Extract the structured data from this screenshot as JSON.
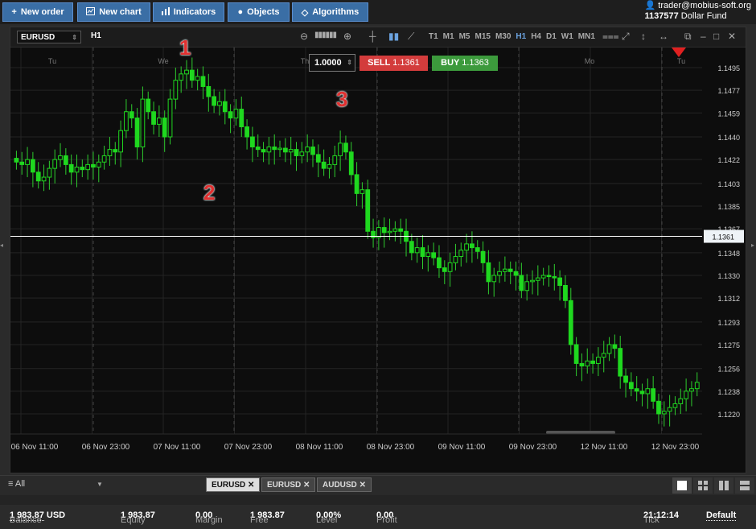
{
  "toolbar": {
    "new_order": "New order",
    "new_chart": "New chart",
    "indicators": "Indicators",
    "objects": "Objects",
    "algorithms": "Algorithms"
  },
  "account": {
    "email": "trader@mobius-soft.org",
    "number": "1137577",
    "fund": "Dollar Fund"
  },
  "chart": {
    "symbol": "EURUSD",
    "timeframe": "H1",
    "timeframes": [
      "T1",
      "M1",
      "M5",
      "M15",
      "M30",
      "H1",
      "H4",
      "D1",
      "W1",
      "MN1"
    ],
    "active_timeframe": "H1",
    "quantity": "1.0000",
    "sell_label": "SELL",
    "sell_price": "1.1361",
    "buy_label": "BUY",
    "buy_price": "1.1363",
    "current_price": "1.1361",
    "day_labels": [
      "Tu",
      "We",
      "Th",
      "Mo",
      "Tu"
    ],
    "annotations": [
      "1",
      "2",
      "3"
    ]
  },
  "chart_data": {
    "type": "candlestick",
    "x_ticks": [
      "06 Nov 11:00",
      "06 Nov 23:00",
      "07 Nov 11:00",
      "07 Nov 23:00",
      "08 Nov 11:00",
      "08 Nov 23:00",
      "09 Nov 11:00",
      "09 Nov 23:00",
      "12 Nov 11:00",
      "12 Nov 23:00"
    ],
    "y_ticks": [
      "1.1495",
      "1.1477",
      "1.1459",
      "1.1440",
      "1.1422",
      "1.1403",
      "1.1385",
      "1.1367",
      "1.1348",
      "1.1330",
      "1.1312",
      "1.1293",
      "1.1275",
      "1.1256",
      "1.1238",
      "1.1220"
    ],
    "ylim": [
      1.1204,
      1.1511
    ],
    "close_series": [
      1.142,
      1.1418,
      1.1422,
      1.1412,
      1.1405,
      1.1408,
      1.1415,
      1.1422,
      1.1425,
      1.1418,
      1.1412,
      1.1416,
      1.1414,
      1.1418,
      1.1416,
      1.142,
      1.1425,
      1.143,
      1.1428,
      1.1445,
      1.146,
      1.1455,
      1.1432,
      1.147,
      1.146,
      1.145,
      1.1455,
      1.144,
      1.147,
      1.1485,
      1.149,
      1.1493,
      1.1485,
      1.1488,
      1.148,
      1.1472,
      1.1465,
      1.1468,
      1.146,
      1.1455,
      1.1462,
      1.1448,
      1.144,
      1.1432,
      1.143,
      1.1428,
      1.1432,
      1.143,
      1.1431,
      1.1428,
      1.143,
      1.1425,
      1.1428,
      1.1432,
      1.1426,
      1.142,
      1.1415,
      1.1418,
      1.1425,
      1.1435,
      1.1428,
      1.141,
      1.1395,
      1.1398,
      1.1365,
      1.136,
      1.1368,
      1.1364,
      1.1365,
      1.1367,
      1.1365,
      1.1357,
      1.1348,
      1.1352,
      1.1345,
      1.1348,
      1.1344,
      1.1336,
      1.1333,
      1.134,
      1.1345,
      1.135,
      1.1355,
      1.1352,
      1.1349,
      1.134,
      1.1325,
      1.133,
      1.1333,
      1.1335,
      1.1333,
      1.133,
      1.1318,
      1.1325,
      1.1326,
      1.1328,
      1.133,
      1.1329,
      1.1328,
      1.1322,
      1.131,
      1.1275,
      1.126,
      1.1258,
      1.1262,
      1.126,
      1.1265,
      1.1268,
      1.1275,
      1.1272,
      1.125,
      1.1245,
      1.124,
      1.1238,
      1.1236,
      1.124,
      1.123,
      1.122,
      1.1222,
      1.1225,
      1.1228,
      1.1232,
      1.1238,
      1.124,
      1.1245
    ]
  },
  "bottom_tabs": {
    "filter": "All",
    "tabs": [
      "EURUSD",
      "EURUSD",
      "AUDUSD"
    ]
  },
  "status": {
    "balance_label": "Balance",
    "balance": "1 983.87",
    "currency": "USD",
    "equity_label": "Equity",
    "equity": "1 983.87",
    "margin_label": "Margin",
    "margin": "0.00",
    "free_label": "Free",
    "free": "1 983.87",
    "level_label": "Level",
    "level": "0.00%",
    "profit_label": "Profit",
    "profit": "0.00",
    "tick_label": "Tick",
    "tick": "21:12:14",
    "default_label": "Default"
  }
}
